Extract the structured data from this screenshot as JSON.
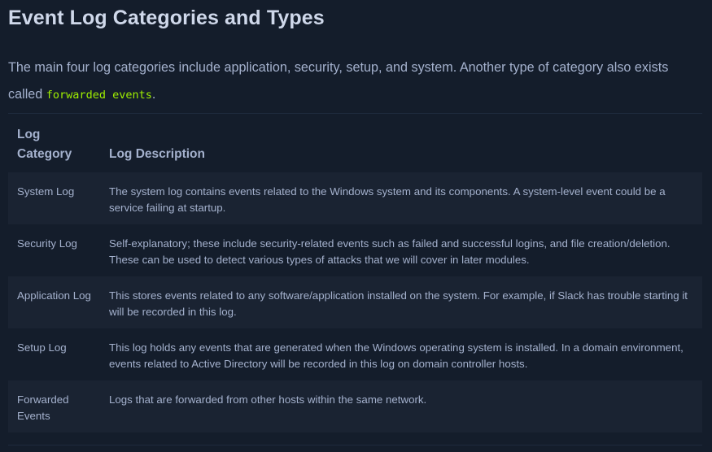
{
  "heading": "Event Log Categories and Types",
  "intro": {
    "text": "The main four log categories include application, security, setup, and system. Another type of category also exists called",
    "code": "forwarded events",
    "end": "."
  },
  "table": {
    "headers": [
      "Log Category",
      "Log Description"
    ],
    "rows": [
      {
        "category": "System Log",
        "description": "The system log contains events related to the Windows system and its components. A system-level event could be a service failing at startup."
      },
      {
        "category": "Security Log",
        "description": "Self-explanatory; these include security-related events such as failed and successful logins, and file creation/deletion. These can be used to detect various types of attacks that we will cover in later modules."
      },
      {
        "category": "Application Log",
        "description": "This stores events related to any software/application installed on the system. For example, if Slack has trouble starting it will be recorded in this log."
      },
      {
        "category": "Setup Log",
        "description": "This log holds any events that are generated when the Windows operating system is installed. In a domain environment, events related to Active Directory will be recorded in this log on domain controller hosts."
      },
      {
        "category": "Forwarded Events",
        "description": "Logs that are forwarded from other hosts within the same network."
      }
    ]
  },
  "colors": {
    "background": "#141d2b",
    "row_shade": "#1a2332",
    "text": "#a4b1cd",
    "heading": "#cfd8ea",
    "code": "#9fef00"
  }
}
